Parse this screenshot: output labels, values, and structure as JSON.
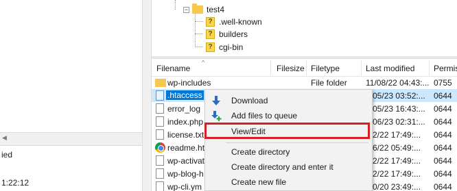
{
  "tree": {
    "items": [
      {
        "label": "test4",
        "icon": "folder-icon",
        "expanded": true
      },
      {
        "label": ".well-known",
        "icon": "unknown-folder-icon"
      },
      {
        "label": "builders",
        "icon": "unknown-folder-icon"
      },
      {
        "label": "cgi-bin",
        "icon": "unknown-folder-icon"
      }
    ]
  },
  "left_bottom": {
    "line1": "ied",
    "line2": "1:22:12"
  },
  "file_list": {
    "columns": [
      "Filename",
      "Filesize",
      "Filetype",
      "Last modified",
      "Permis"
    ],
    "rows": [
      {
        "name": "wp-includes",
        "size": "",
        "type": "File folder",
        "modified": "11/08/22 04:43:...",
        "perms": "0755",
        "icon": "folder-icon"
      },
      {
        "name": ".htaccess",
        "size": "",
        "type": "",
        "modified": "4/05/23 03:52:...",
        "perms": "0644",
        "icon": "file-icon",
        "selected": true
      },
      {
        "name": "error_log",
        "size": "",
        "type": "",
        "modified": "4/05/23 16:43:...",
        "perms": "0644",
        "icon": "file-icon"
      },
      {
        "name": "index.php",
        "size": "",
        "type": "",
        "modified": "2/06/23 02:31:...",
        "perms": "0644",
        "icon": "file-icon"
      },
      {
        "name": "license.txt",
        "size": "",
        "type": "",
        "modified": "/02/22 17:49:...",
        "perms": "0644",
        "icon": "file-icon"
      },
      {
        "name": "readme.ht",
        "size": "",
        "type": "",
        "modified": "/16/22 05:49:...",
        "perms": "0644",
        "icon": "chrome-icon"
      },
      {
        "name": "wp-activat",
        "size": "",
        "type": "",
        "modified": "/02/22 17:49:...",
        "perms": "0644",
        "icon": "file-icon"
      },
      {
        "name": "wp-blog-h",
        "size": "",
        "type": "",
        "modified": "/02/22 17:49:...",
        "perms": "0644",
        "icon": "file-icon"
      },
      {
        "name": "wp-cli.ym",
        "size": "",
        "type": "",
        "modified": "/30/20 23:49:...",
        "perms": "0644",
        "icon": "file-icon"
      }
    ]
  },
  "context_menu": {
    "items": [
      {
        "label": "Download",
        "icon": "download-arrow-icon"
      },
      {
        "label": "Add files to queue",
        "icon": "add-to-queue-icon"
      },
      {
        "label": "View/Edit",
        "icon": ""
      },
      {
        "label": "Create directory",
        "icon": ""
      },
      {
        "label": "Create directory and enter it",
        "icon": ""
      },
      {
        "label": "Create new file",
        "icon": ""
      }
    ],
    "highlighted_item": "View/Edit",
    "highlight_color": "#d81f26"
  },
  "colors": {
    "selection_bg": "#0078d7",
    "selection_row": "#cce8ff",
    "folder": "#f6c94e"
  }
}
